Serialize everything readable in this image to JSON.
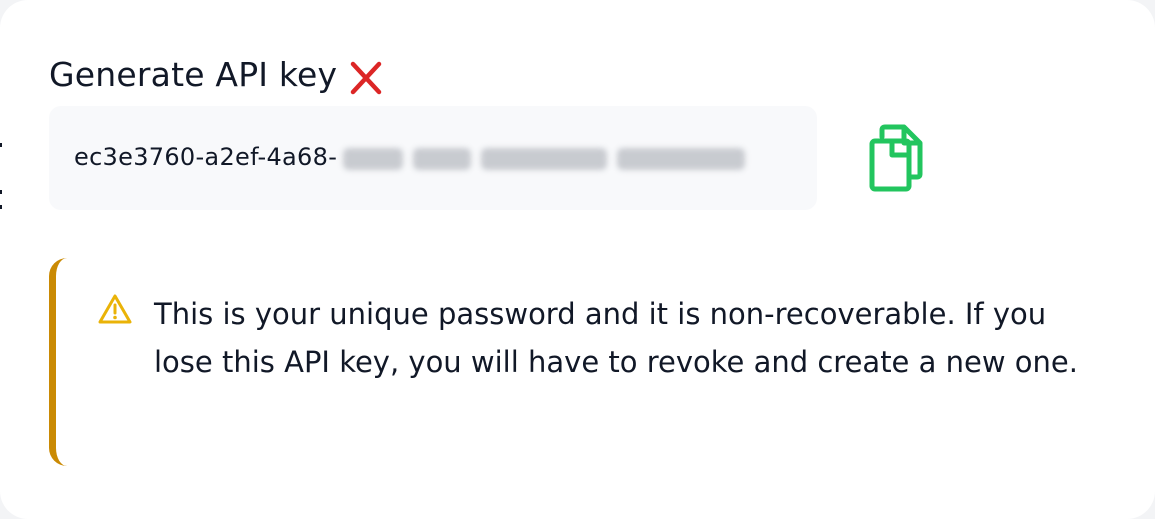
{
  "dialog": {
    "title": "Generate API key",
    "close_icon": "close-x-icon",
    "close_color": "#dc2626"
  },
  "api_key": {
    "visible_prefix": "ec3e3760-a2ef-4a68-",
    "remainder_obscured": true,
    "background": "#f8f9fb"
  },
  "copy": {
    "icon": "copy-icon",
    "color": "#22c55e"
  },
  "alert": {
    "icon": "warning-triangle-icon",
    "icon_color": "#eab308",
    "accent_color": "#ca8a04",
    "message": "This is your unique password and it is non-recoverable. If you lose this API key, you will have to revoke and create a new one."
  }
}
